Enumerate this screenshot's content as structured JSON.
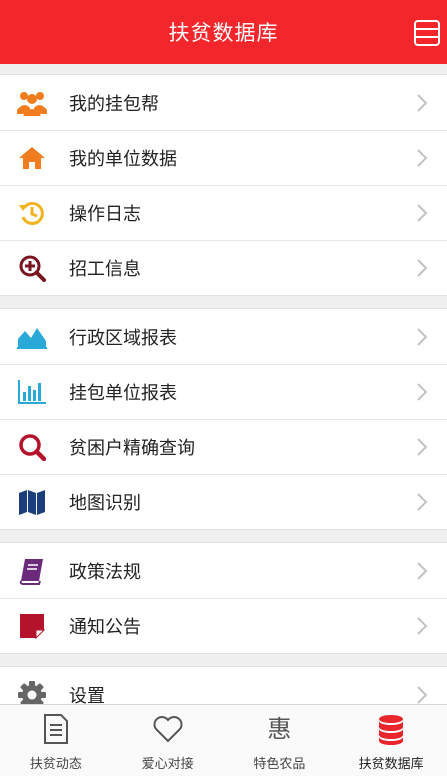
{
  "header": {
    "title": "扶贫数据库"
  },
  "groups": [
    {
      "items": [
        {
          "label": "我的挂包帮"
        },
        {
          "label": "我的单位数据"
        },
        {
          "label": "操作日志"
        },
        {
          "label": "招工信息"
        }
      ]
    },
    {
      "items": [
        {
          "label": "行政区域报表"
        },
        {
          "label": "挂包单位报表"
        },
        {
          "label": "贫困户精确查询"
        },
        {
          "label": "地图识别"
        }
      ]
    },
    {
      "items": [
        {
          "label": "政策法规"
        },
        {
          "label": "通知公告"
        }
      ]
    },
    {
      "items": [
        {
          "label": "设置"
        }
      ]
    }
  ],
  "tabbar": {
    "hui_glyph": "惠",
    "tabs": [
      {
        "label": "扶贫动态"
      },
      {
        "label": "爱心对接"
      },
      {
        "label": "特色农品"
      },
      {
        "label": "扶贫数据库"
      }
    ]
  },
  "colors": {
    "header_bg": "#f2262b",
    "orange": "#f07d1e",
    "gold": "#f0b31e",
    "maroon": "#7a1420",
    "cyan": "#29a9d8",
    "dark_blue": "#1b3f7a",
    "crimson": "#b5122b",
    "purple": "#6b2a7a"
  }
}
